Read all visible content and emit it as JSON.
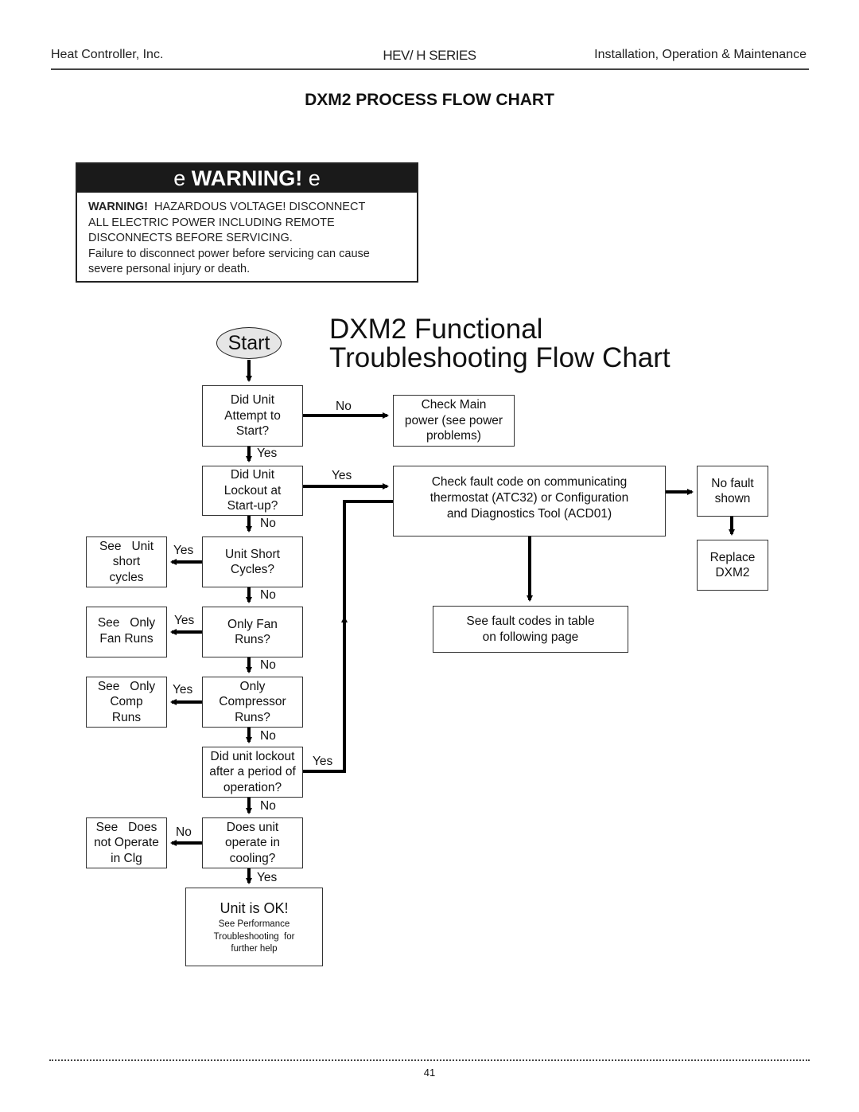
{
  "header": {
    "company": "Heat Controller, Inc.",
    "series": "HEV/ H SERIES",
    "manual": "Installation, Operation & Maintenance"
  },
  "page_title": "DXM2 PROCESS FLOW CHART",
  "warning": {
    "icon_glyph": "e",
    "title": "WARNING!",
    "lead": "WARNING!",
    "line1": "HAZARDOUS VOLTAGE! DISCONNECT",
    "line2": "ALL ELECTRIC POWER INCLUDING REMOTE",
    "line3": "DISCONNECTS BEFORE SERVICING.",
    "line4": "Failure to disconnect power before servicing can cause",
    "line5": "severe personal injury or death."
  },
  "flowchart": {
    "title_line1": "DXM2  Functional",
    "title_line2": "Troubleshooting Flow Chart",
    "start": "Start",
    "nodes": {
      "attempt_start": [
        "Did Unit",
        "Attempt to",
        "Start?"
      ],
      "check_main_power": [
        "Check Main",
        "power (see power",
        "problems)"
      ],
      "lockout_startup": [
        "Did Unit",
        "Lockout at",
        "Start-up?"
      ],
      "check_fault_code": [
        "Check fault code on communicating",
        "thermostat (ATC32) or Configuration",
        "and Diagnostics Tool (ACD01)"
      ],
      "no_fault_shown": [
        "No fault",
        "shown"
      ],
      "replace_dxm2": [
        "Replace",
        "DXM2"
      ],
      "see_fault_codes": [
        "See fault codes in table",
        "on following page"
      ],
      "short_cycles": [
        "Unit Short",
        "Cycles?"
      ],
      "see_short_cycles": [
        "See   Unit",
        "short",
        "cycles"
      ],
      "only_fan": [
        "Only Fan",
        "Runs?"
      ],
      "see_only_fan": [
        "See   Only",
        "Fan Runs"
      ],
      "only_comp": [
        "Only",
        "Compressor",
        "Runs?"
      ],
      "see_only_comp": [
        "See   Only",
        "Comp",
        "Runs"
      ],
      "lockout_period": [
        "Did unit lockout",
        "after a period of",
        "operation?"
      ],
      "operate_cooling": [
        "Does unit",
        "operate in",
        "cooling?"
      ],
      "see_not_operate": [
        "See   Does",
        "not Operate",
        "in Clg"
      ],
      "unit_ok": {
        "main": "Unit is OK!",
        "sub1": "See Performance",
        "sub2": "Troubleshooting  for",
        "sub3": "further help"
      }
    },
    "edge_labels": {
      "attempt_no": "No",
      "attempt_yes": "Yes",
      "lockout_yes": "Yes",
      "lockout_no": "No",
      "short_yes": "Yes",
      "short_no": "No",
      "fan_yes": "Yes",
      "fan_no": "No",
      "comp_yes": "Yes",
      "comp_no": "No",
      "period_yes": "Yes",
      "period_no": "No",
      "cooling_no": "No",
      "cooling_yes": "Yes"
    }
  },
  "footer": {
    "page_number": "41"
  }
}
